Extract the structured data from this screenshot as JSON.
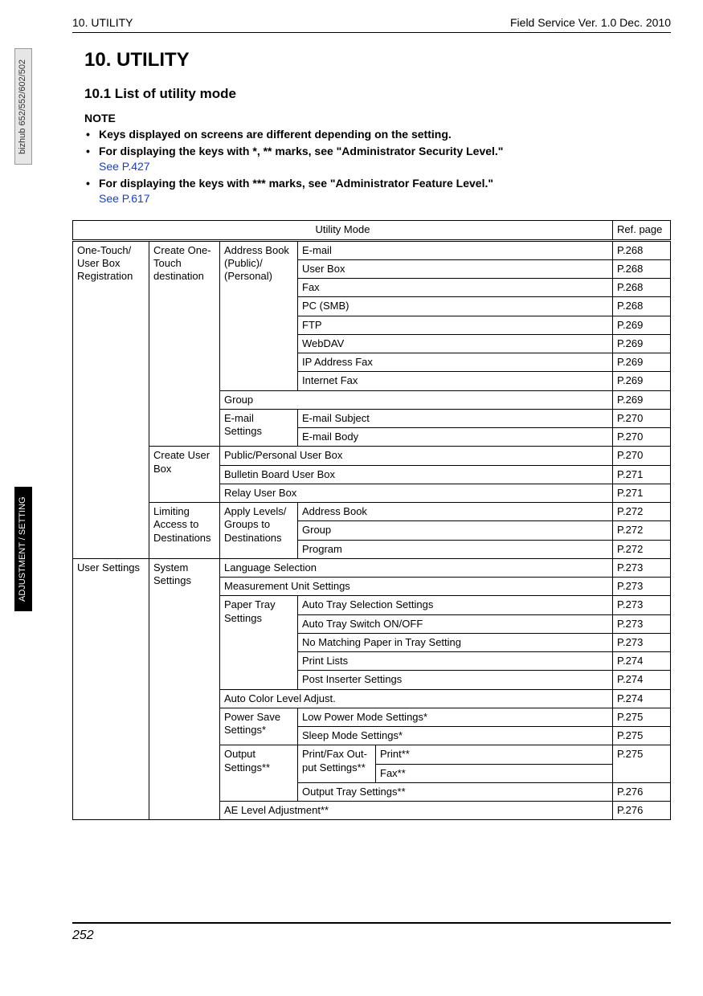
{
  "header": {
    "left": "10. UTILITY",
    "right": "Field Service Ver. 1.0 Dec. 2010"
  },
  "sidetabs": {
    "model": "bizhub 652/552/602/502",
    "section": "ADJUSTMENT / SETTING"
  },
  "chapter": "10.  UTILITY",
  "section": "10.1    List of utility mode",
  "note_label": "NOTE",
  "bullets": [
    {
      "bold": "Keys displayed on screens are different depending on the setting."
    },
    {
      "bold": "For displaying the keys with *, ** marks, see \"Administrator Security Level.\"",
      "link": "See P.427"
    },
    {
      "bold": "For displaying the keys with *** marks, see \"Administrator Feature Level.\"",
      "link": "See P.617"
    }
  ],
  "table": {
    "head_mode": "Utility Mode",
    "head_ref": "Ref. page",
    "groups": {
      "onetouch": "One-Touch/ User Box Registration",
      "create_dest": "Create One-Touch destination",
      "addr_book": "Address Book (Public)/ (Personal)",
      "email_settings": "E-mail Settings",
      "create_ubox": "Create User Box",
      "limiting": "Limiting Access to Destina­tions",
      "apply_levels": "Apply Levels/ Groups to Destinations",
      "user_settings": "User Settings",
      "system_settings": "System Settings",
      "paper_tray": "Paper Tray Settings",
      "power_save": "Power Save Settings*",
      "output_settings": "Output Settings**",
      "printfax": "Print/Fax Out­put Settings**"
    },
    "rows": {
      "email": {
        "l": "E-mail",
        "r": "P.268"
      },
      "ubox": {
        "l": "User Box",
        "r": "P.268"
      },
      "fax": {
        "l": "Fax",
        "r": "P.268"
      },
      "pcsmb": {
        "l": "PC (SMB)",
        "r": "P.268"
      },
      "ftp": {
        "l": "FTP",
        "r": "P.269"
      },
      "webdav": {
        "l": "WebDAV",
        "r": "P.269"
      },
      "ipfax": {
        "l": "IP Address Fax",
        "r": "P.269"
      },
      "ifax": {
        "l": "Internet Fax",
        "r": "P.269"
      },
      "group": {
        "l": "Group",
        "r": "P.269"
      },
      "esubj": {
        "l": "E-mail Subject",
        "r": "P.270"
      },
      "ebody": {
        "l": "E-mail Body",
        "r": "P.270"
      },
      "pubpers": {
        "l": "Public/Personal User Box",
        "r": "P.270"
      },
      "bulletin": {
        "l": "Bulletin Board User Box",
        "r": "P.271"
      },
      "relay": {
        "l": "Relay User Box",
        "r": "P.271"
      },
      "addrbook2": {
        "l": "Address Book",
        "r": "P.272"
      },
      "group2": {
        "l": "Group",
        "r": "P.272"
      },
      "program": {
        "l": "Program",
        "r": "P.272"
      },
      "lang": {
        "l": "Language Selection",
        "r": "P.273"
      },
      "meas": {
        "l": "Measurement Unit Settings",
        "r": "P.273"
      },
      "autotray": {
        "l": "Auto Tray Selection Settings",
        "r": "P.273"
      },
      "autoswitch": {
        "l": "Auto Tray Switch ON/OFF",
        "r": "P.273"
      },
      "nomatch": {
        "l": "No Matching Paper in Tray Setting",
        "r": "P.273"
      },
      "printlists": {
        "l": "Print Lists",
        "r": "P.274"
      },
      "postins": {
        "l": "Post Inserter Settings",
        "r": "P.274"
      },
      "autocolor": {
        "l": "Auto Color Level Adjust.",
        "r": "P.274"
      },
      "lowpower": {
        "l": "Low Power Mode Settings*",
        "r": "P.275"
      },
      "sleep": {
        "l": "Sleep Mode Settings*",
        "r": "P.275"
      },
      "print2": {
        "l": "Print**",
        "r": "P.275"
      },
      "fax2": {
        "l": "Fax**"
      },
      "outtray": {
        "l": "Output Tray Settings**",
        "r": "P.276"
      },
      "aelevel": {
        "l": "AE Level Adjustment**",
        "r": "P.276"
      }
    }
  },
  "footer": "252"
}
